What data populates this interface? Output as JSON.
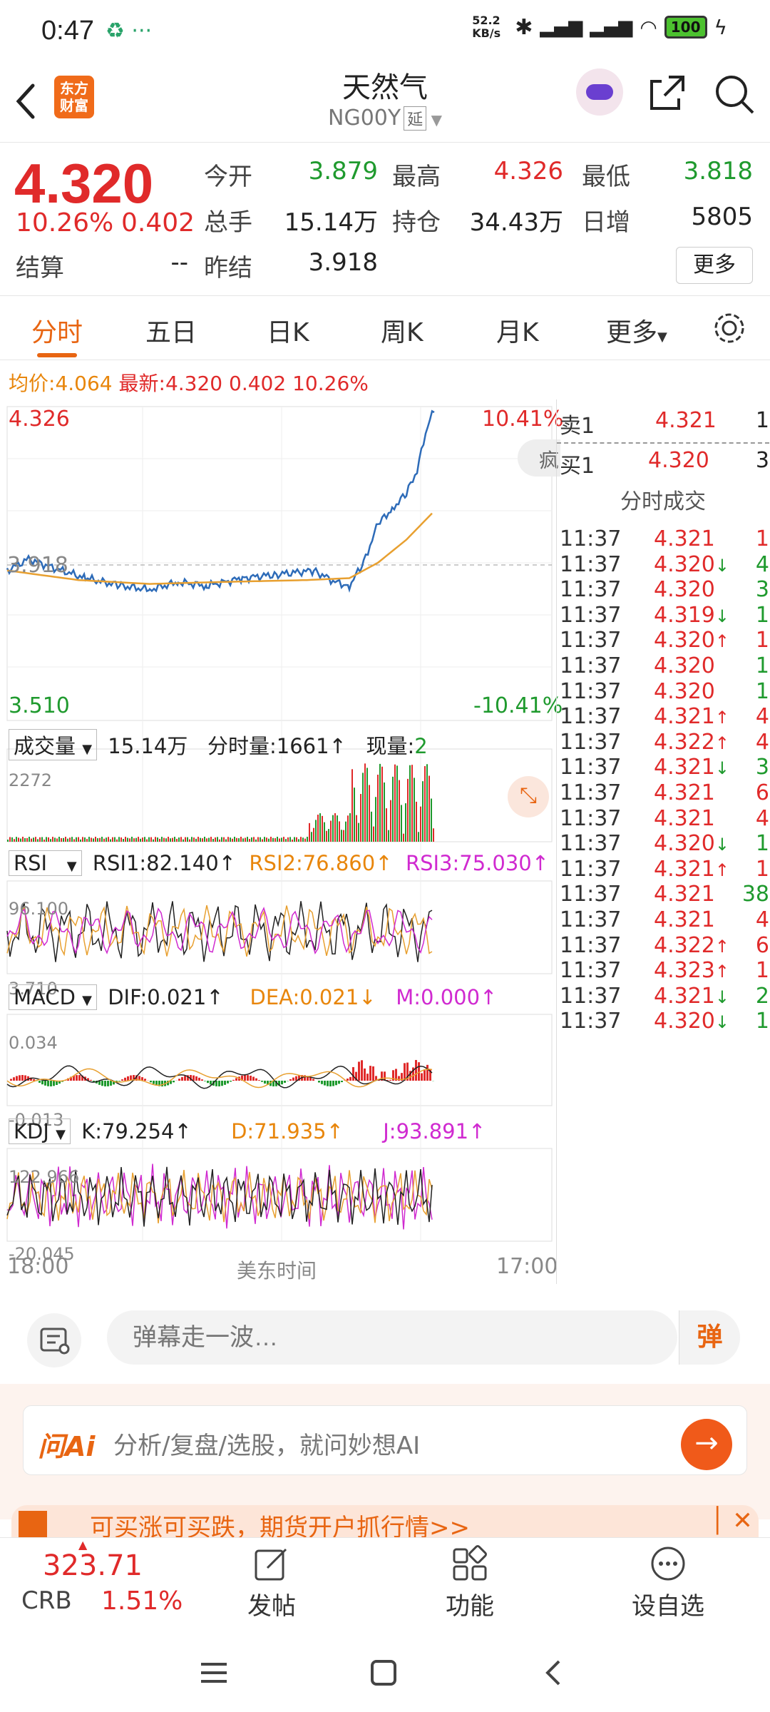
{
  "status_bar": {
    "time": "0:47",
    "net_speed": "52.2 KB/s",
    "battery": "100"
  },
  "header": {
    "title": "天然气",
    "code": "NG00Y",
    "delay_badge": "延",
    "logo_text": "东方财富"
  },
  "quote": {
    "price": "4.320",
    "change_pct": "10.26%",
    "change": "0.402",
    "fields": {
      "open_label": "今开",
      "open": "3.879",
      "high_label": "最高",
      "high": "4.326",
      "low_label": "最低",
      "low": "3.818",
      "volume_label": "总手",
      "volume": "15.14万",
      "oi_label": "持仓",
      "oi": "34.43万",
      "daily_inc_label": "日增",
      "daily_inc": "5805",
      "settle_label": "结算",
      "settle": "--",
      "prev_settle_label": "昨结",
      "prev_settle": "3.918"
    },
    "more_label": "更多"
  },
  "tabs": [
    {
      "label": "分时",
      "active": true
    },
    {
      "label": "五日"
    },
    {
      "label": "日K"
    },
    {
      "label": "周K"
    },
    {
      "label": "月K"
    },
    {
      "label": "更多"
    }
  ],
  "avg_line": {
    "avg_label": "均价:",
    "avg": "4.064",
    "latest_label": "最新:",
    "latest": "4.320",
    "change": "0.402",
    "pct": "10.26%"
  },
  "chart": {
    "ymax": "4.326",
    "ymid": "3.918",
    "ymin": "3.510",
    "pct_max": "10.41%",
    "pct_min": "-10.41%",
    "side_badge": "疯",
    "x_start": "18:00",
    "x_mid": "美东时间",
    "x_end": "17:00"
  },
  "volume_panel": {
    "label": "成交量",
    "total": "15.14万",
    "tick_label": "分时量:1661↑",
    "now_label": "现量:",
    "now": "2",
    "ymax": "2272"
  },
  "rsi_panel": {
    "label": "RSI",
    "rsi1": "RSI1:82.140↑",
    "rsi2": "RSI2:76.860↑",
    "rsi3": "RSI3:75.030↑",
    "ymax": "96.100",
    "ymin": "3.710"
  },
  "macd_panel": {
    "label": "MACD",
    "dif": "DIF:0.021↑",
    "dea": "DEA:0.021↓",
    "m": "M:0.000↑",
    "ymax": "0.034",
    "ymin": "-0.013"
  },
  "kdj_panel": {
    "label": "KDJ",
    "k": "K:79.254↑",
    "d": "D:71.935↑",
    "j": "J:93.891↑",
    "ymax": "122.966",
    "ymin": "-20.045"
  },
  "order_book": {
    "sell_label": "卖1",
    "sell_price": "4.321",
    "sell_vol": "1",
    "buy_label": "买1",
    "buy_price": "4.320",
    "buy_vol": "3",
    "title": "分时成交"
  },
  "trades": [
    {
      "t": "11:37",
      "p": "4.321",
      "a": "",
      "v": "1",
      "c": "red"
    },
    {
      "t": "11:37",
      "p": "4.320",
      "a": "↓",
      "v": "4",
      "c": "green"
    },
    {
      "t": "11:37",
      "p": "4.320",
      "a": "",
      "v": "3",
      "c": "green"
    },
    {
      "t": "11:37",
      "p": "4.319",
      "a": "↓",
      "v": "1",
      "c": "green"
    },
    {
      "t": "11:37",
      "p": "4.320",
      "a": "↑",
      "v": "1",
      "c": "red"
    },
    {
      "t": "11:37",
      "p": "4.320",
      "a": "",
      "v": "1",
      "c": "green"
    },
    {
      "t": "11:37",
      "p": "4.320",
      "a": "",
      "v": "1",
      "c": "green"
    },
    {
      "t": "11:37",
      "p": "4.321",
      "a": "↑",
      "v": "4",
      "c": "red"
    },
    {
      "t": "11:37",
      "p": "4.322",
      "a": "↑",
      "v": "4",
      "c": "red"
    },
    {
      "t": "11:37",
      "p": "4.321",
      "a": "↓",
      "v": "3",
      "c": "green"
    },
    {
      "t": "11:37",
      "p": "4.321",
      "a": "",
      "v": "6",
      "c": "red"
    },
    {
      "t": "11:37",
      "p": "4.321",
      "a": "",
      "v": "4",
      "c": "red"
    },
    {
      "t": "11:37",
      "p": "4.320",
      "a": "↓",
      "v": "1",
      "c": "green"
    },
    {
      "t": "11:37",
      "p": "4.321",
      "a": "↑",
      "v": "1",
      "c": "red"
    },
    {
      "t": "11:37",
      "p": "4.321",
      "a": "",
      "v": "38",
      "c": "green"
    },
    {
      "t": "11:37",
      "p": "4.321",
      "a": "",
      "v": "4",
      "c": "red"
    },
    {
      "t": "11:37",
      "p": "4.322",
      "a": "↑",
      "v": "6",
      "c": "red"
    },
    {
      "t": "11:37",
      "p": "4.323",
      "a": "↑",
      "v": "1",
      "c": "red"
    },
    {
      "t": "11:37",
      "p": "4.321",
      "a": "↓",
      "v": "2",
      "c": "green"
    },
    {
      "t": "11:37",
      "p": "4.320",
      "a": "↓",
      "v": "1",
      "c": "green"
    }
  ],
  "danmaku": {
    "placeholder": "弹幕走一波…",
    "send_label": "弹"
  },
  "ai": {
    "logo": "问Ai",
    "placeholder": "分析/复盘/选股，就问妙想AI"
  },
  "banner": {
    "text": "可买涨可买跌，期货开户抓行情>>"
  },
  "bottom_bar": {
    "crb_value": "323.71",
    "crb_name": "CRB",
    "crb_pct": "1.51%",
    "post_label": "发帖",
    "func_label": "功能",
    "watch_label": "设自选"
  },
  "colors": {
    "up": "#e02a2a",
    "down": "#1f9a2e",
    "accent": "#e86512",
    "price_line": "#2d6bb8",
    "avg_line": "#e8a030"
  }
}
